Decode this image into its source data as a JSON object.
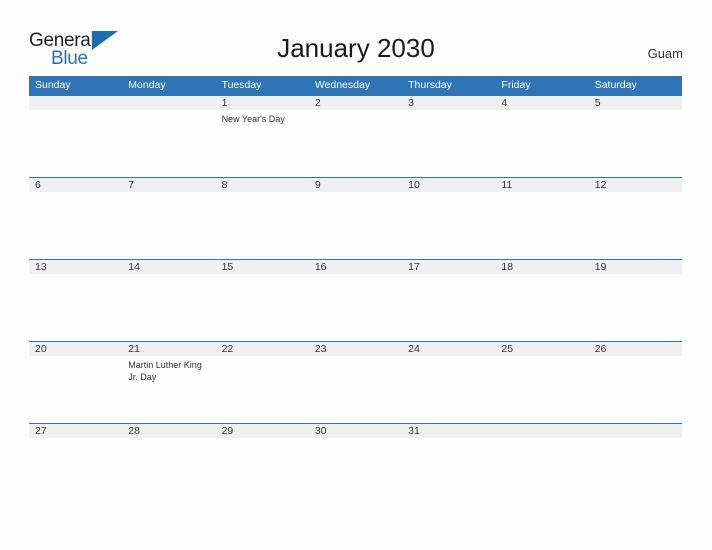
{
  "brand": {
    "word_general": "General",
    "word_blue": "Blue",
    "flag_icon": "blue-flag-triangle",
    "accent_color": "#1c75bc"
  },
  "header": {
    "title": "January 2030",
    "location": "Guam"
  },
  "theme": {
    "header_blue": "#2f74b5",
    "row_band_gray": "#f0f0f0",
    "page_background": "#fdfdfd",
    "text_color": "#333333"
  },
  "calendar": {
    "month": "January",
    "year": "2030",
    "weekday_headers": [
      "Sunday",
      "Monday",
      "Tuesday",
      "Wednesday",
      "Thursday",
      "Friday",
      "Saturday"
    ],
    "weeks": [
      [
        {
          "day": "",
          "event": ""
        },
        {
          "day": "",
          "event": ""
        },
        {
          "day": "1",
          "event": "New Year's Day"
        },
        {
          "day": "2",
          "event": ""
        },
        {
          "day": "3",
          "event": ""
        },
        {
          "day": "4",
          "event": ""
        },
        {
          "day": "5",
          "event": ""
        }
      ],
      [
        {
          "day": "6",
          "event": ""
        },
        {
          "day": "7",
          "event": ""
        },
        {
          "day": "8",
          "event": ""
        },
        {
          "day": "9",
          "event": ""
        },
        {
          "day": "10",
          "event": ""
        },
        {
          "day": "11",
          "event": ""
        },
        {
          "day": "12",
          "event": ""
        }
      ],
      [
        {
          "day": "13",
          "event": ""
        },
        {
          "day": "14",
          "event": ""
        },
        {
          "day": "15",
          "event": ""
        },
        {
          "day": "16",
          "event": ""
        },
        {
          "day": "17",
          "event": ""
        },
        {
          "day": "18",
          "event": ""
        },
        {
          "day": "19",
          "event": ""
        }
      ],
      [
        {
          "day": "20",
          "event": ""
        },
        {
          "day": "21",
          "event": "Martin Luther King Jr. Day"
        },
        {
          "day": "22",
          "event": ""
        },
        {
          "day": "23",
          "event": ""
        },
        {
          "day": "24",
          "event": ""
        },
        {
          "day": "25",
          "event": ""
        },
        {
          "day": "26",
          "event": ""
        }
      ],
      [
        {
          "day": "27",
          "event": ""
        },
        {
          "day": "28",
          "event": ""
        },
        {
          "day": "29",
          "event": ""
        },
        {
          "day": "30",
          "event": ""
        },
        {
          "day": "31",
          "event": ""
        },
        {
          "day": "",
          "event": ""
        },
        {
          "day": "",
          "event": ""
        }
      ]
    ]
  }
}
